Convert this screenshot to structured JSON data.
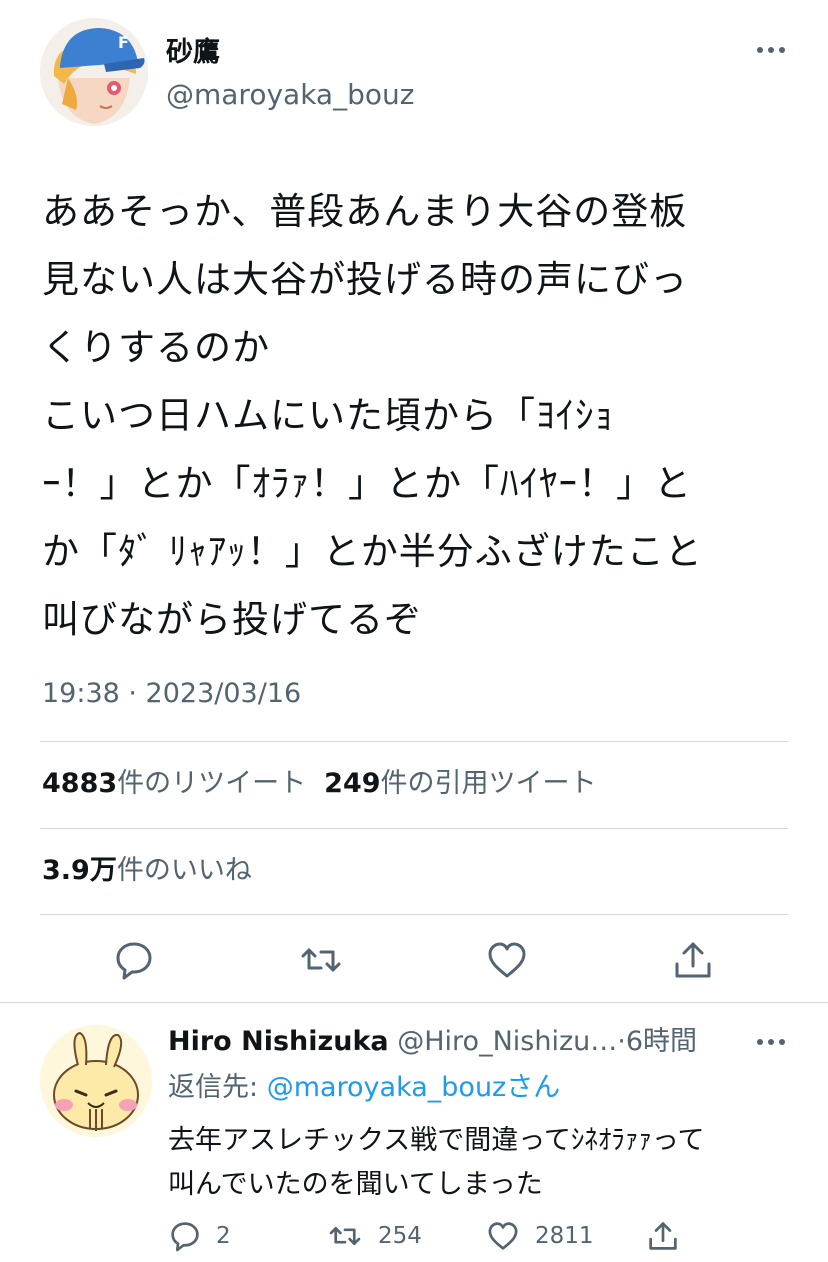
{
  "tweet": {
    "author_name": "砂鷹",
    "author_handle": "@maroyaka_bouz",
    "text": "ああそっか、普段あんまり大谷の登板\n見ない人は大谷が投げる時の声にびっ\nくりするのか\nこいつ日ハムにいた頃から「ﾖｲｼｮ\nｰ！」とか「ｵﾗｧ！」とか「ﾊｲﾔｰ！」と\nか「ﾀﾞ ﾘｬｱｯ！」とか半分ふざけたこと\n叫びながら投げてるぞ",
    "timestamp": "19:38 · 2023/03/16",
    "retweets_count": "4883",
    "retweets_label": "件のリツイート",
    "quotes_count": "249",
    "quotes_label": "件の引用ツイート",
    "likes_count": "3.9万",
    "likes_label": "件のいいね",
    "icons": [
      "reply-icon",
      "retweet-icon",
      "like-icon",
      "share-icon",
      "more-icon"
    ]
  },
  "reply": {
    "author_name": "Hiro Nishizuka",
    "author_handle": "@Hiro_Nishizu…",
    "time": "6時間",
    "reply_to_prefix": "返信先: ",
    "reply_to_handle": "@maroyaka_bouz",
    "reply_to_suffix": "さん",
    "text": "去年アスレチックス戦で間違ってｼﾈｵﾗｧｧって\n叫んでいたのを聞いてしまった",
    "reply_count": "2",
    "retweet_count": "254",
    "like_count": "2811"
  },
  "colors": {
    "text": "#0f1419",
    "secondary": "#536471",
    "link": "#1d9bf0",
    "divider": "#cfd9de"
  }
}
